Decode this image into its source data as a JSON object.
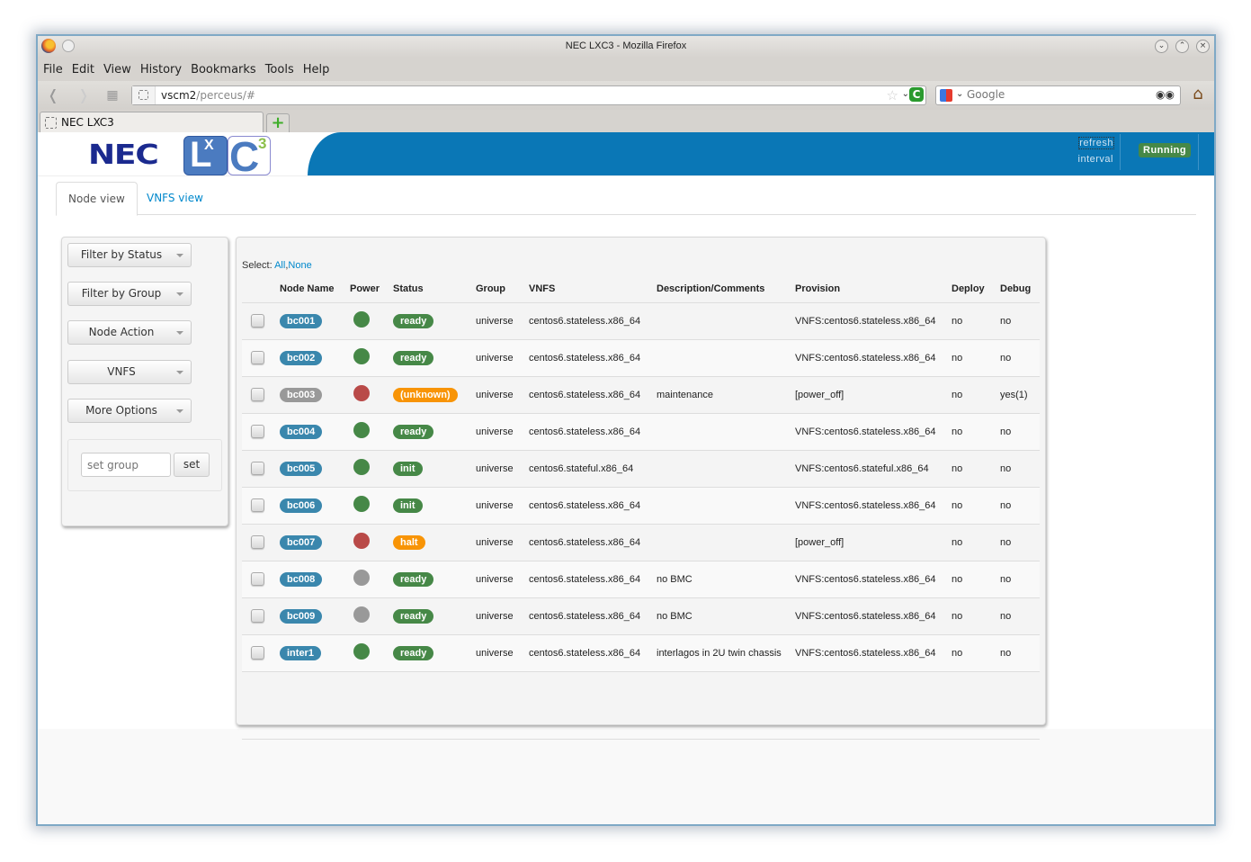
{
  "browser": {
    "window_title": "NEC LXC3 - Mozilla Firefox",
    "menu": [
      "File",
      "Edit",
      "View",
      "History",
      "Bookmarks",
      "Tools",
      "Help"
    ],
    "url_host": "vscm2",
    "url_path": "/perceus/#",
    "search_placeholder": "Google",
    "tab_title": "NEC LXC3",
    "new_tab_glyph": "+"
  },
  "header": {
    "brand": "NEC",
    "logo_l": "L",
    "logo_x": "X",
    "logo_c": "C",
    "logo_3": "3",
    "refresh_line1": "refresh",
    "refresh_line2": "interval",
    "status_badge": "Running",
    "colors": {
      "header_blue": "#0a77b6",
      "running_green": "#468847"
    }
  },
  "tabs": [
    {
      "label": "Node view",
      "active": true
    },
    {
      "label": "VNFS view",
      "active": false
    }
  ],
  "sidebar": {
    "buttons": [
      "Filter by Status",
      "Filter by Group",
      "Node Action",
      "VNFS",
      "More Options"
    ],
    "group_input_placeholder": "set group",
    "set_label": "set"
  },
  "table": {
    "select_label": "Select:",
    "select_all": "All",
    "select_sep": ",",
    "select_none": "None",
    "columns": [
      "",
      "Node Name",
      "Power",
      "Status",
      "Group",
      "VNFS",
      "Description/Comments",
      "Provision",
      "Deploy",
      "Debug"
    ],
    "rows": [
      {
        "name": "bc001",
        "name_color": "#3a87ad",
        "power": "on",
        "status": "ready",
        "status_color": "#468847",
        "group": "universe",
        "vnfs": "centos6.stateless.x86_64",
        "desc": "",
        "provision": "VNFS:centos6.stateless.x86_64",
        "deploy": "no",
        "debug": "no"
      },
      {
        "name": "bc002",
        "name_color": "#3a87ad",
        "power": "on",
        "status": "ready",
        "status_color": "#468847",
        "group": "universe",
        "vnfs": "centos6.stateless.x86_64",
        "desc": "",
        "provision": "VNFS:centos6.stateless.x86_64",
        "deploy": "no",
        "debug": "no"
      },
      {
        "name": "bc003",
        "name_color": "#999999",
        "power": "off",
        "status": "(unknown)",
        "status_color": "#f89406",
        "group": "universe",
        "vnfs": "centos6.stateless.x86_64",
        "desc": "maintenance",
        "provision": "[power_off]",
        "deploy": "no",
        "debug": "yes(1)"
      },
      {
        "name": "bc004",
        "name_color": "#3a87ad",
        "power": "on",
        "status": "ready",
        "status_color": "#468847",
        "group": "universe",
        "vnfs": "centos6.stateless.x86_64",
        "desc": "",
        "provision": "VNFS:centos6.stateless.x86_64",
        "deploy": "no",
        "debug": "no"
      },
      {
        "name": "bc005",
        "name_color": "#3a87ad",
        "power": "on",
        "status": "init",
        "status_color": "#468847",
        "group": "universe",
        "vnfs": "centos6.stateful.x86_64",
        "desc": "",
        "provision": "VNFS:centos6.stateful.x86_64",
        "deploy": "no",
        "debug": "no"
      },
      {
        "name": "bc006",
        "name_color": "#3a87ad",
        "power": "on",
        "status": "init",
        "status_color": "#468847",
        "group": "universe",
        "vnfs": "centos6.stateless.x86_64",
        "desc": "",
        "provision": "VNFS:centos6.stateless.x86_64",
        "deploy": "no",
        "debug": "no"
      },
      {
        "name": "bc007",
        "name_color": "#3a87ad",
        "power": "off",
        "status": "halt",
        "status_color": "#f89406",
        "group": "universe",
        "vnfs": "centos6.stateless.x86_64",
        "desc": "",
        "provision": "[power_off]",
        "deploy": "no",
        "debug": "no"
      },
      {
        "name": "bc008",
        "name_color": "#3a87ad",
        "power": "unknown",
        "status": "ready",
        "status_color": "#468847",
        "group": "universe",
        "vnfs": "centos6.stateless.x86_64",
        "desc": "no BMC",
        "provision": "VNFS:centos6.stateless.x86_64",
        "deploy": "no",
        "debug": "no"
      },
      {
        "name": "bc009",
        "name_color": "#3a87ad",
        "power": "unknown",
        "status": "ready",
        "status_color": "#468847",
        "group": "universe",
        "vnfs": "centos6.stateless.x86_64",
        "desc": "no BMC",
        "provision": "VNFS:centos6.stateless.x86_64",
        "deploy": "no",
        "debug": "no"
      },
      {
        "name": "inter1",
        "name_color": "#3a87ad",
        "power": "on",
        "status": "ready",
        "status_color": "#468847",
        "group": "universe",
        "vnfs": "centos6.stateless.x86_64",
        "desc": "interlagos in 2U twin chassis",
        "provision": "VNFS:centos6.stateless.x86_64",
        "deploy": "no",
        "debug": "no"
      }
    ],
    "power_colors": {
      "on": "#468847",
      "off": "#b94a48",
      "unknown": "#999999"
    }
  }
}
